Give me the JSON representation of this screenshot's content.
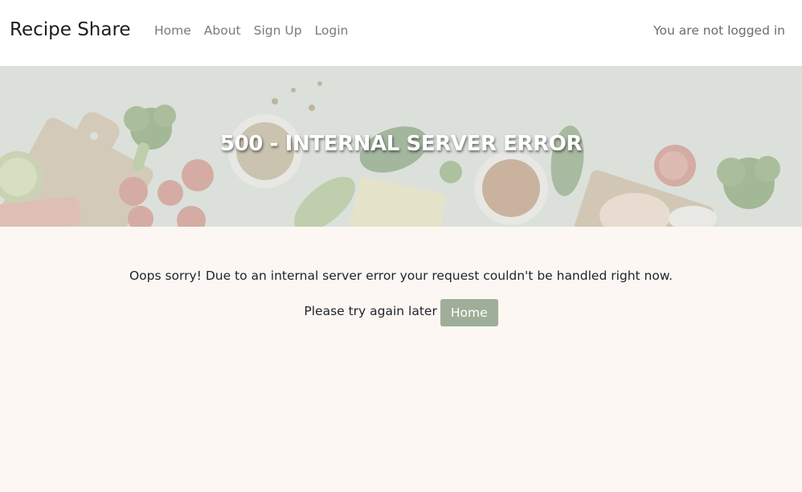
{
  "navbar": {
    "brand": "Recipe Share",
    "links": [
      {
        "label": "Home"
      },
      {
        "label": "About"
      },
      {
        "label": "Sign Up"
      },
      {
        "label": "Login"
      }
    ],
    "status": "You are not logged in"
  },
  "hero": {
    "title": "500 - INTERNAL SERVER ERROR"
  },
  "main": {
    "message": "Oops sorry! Due to an internal server error your request couldn't be handled right now.",
    "retry_text": "Please try again later",
    "home_button": "Home"
  },
  "colors": {
    "button_bg": "#9fae98",
    "page_bg": "#fcf7f3",
    "navbar_bg": "#ffffff"
  }
}
